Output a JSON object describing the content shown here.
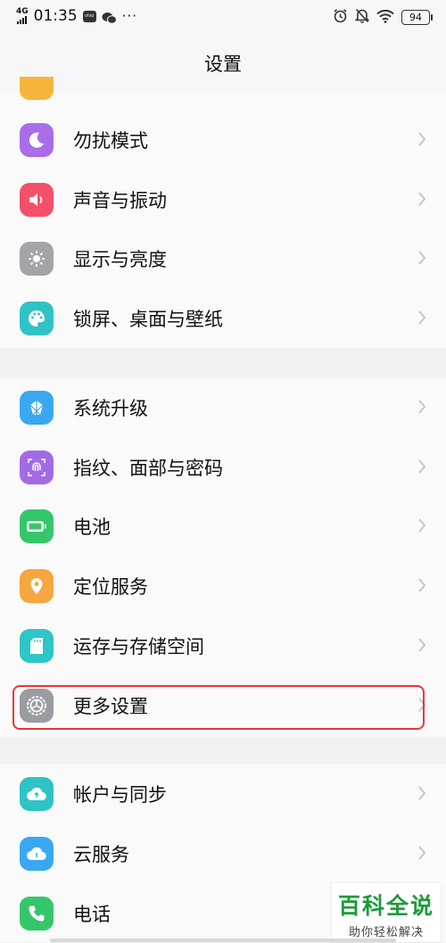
{
  "status_bar": {
    "network": "4G",
    "time": "01:35",
    "app_badge": "vivo",
    "battery": "94"
  },
  "header": {
    "title": "设置"
  },
  "sections": [
    {
      "items": [
        {
          "label": "勿扰模式",
          "icon": "moon-icon",
          "color": "#a76ee8"
        },
        {
          "label": "声音与振动",
          "icon": "speaker-icon",
          "color": "#f2506b"
        },
        {
          "label": "显示与亮度",
          "icon": "sun-icon",
          "color": "#a3a3a8"
        },
        {
          "label": "锁屏、桌面与壁纸",
          "icon": "palette-icon",
          "color": "#2fc3c5"
        }
      ]
    },
    {
      "items": [
        {
          "label": "系统升级",
          "icon": "system-upgrade-icon",
          "color": "#3aa8f0"
        },
        {
          "label": "指纹、面部与密码",
          "icon": "fingerprint-icon",
          "color": "#a36ae6"
        },
        {
          "label": "电池",
          "icon": "battery-icon",
          "color": "#34c76a"
        },
        {
          "label": "定位服务",
          "icon": "location-pin-icon",
          "color": "#f7a640"
        },
        {
          "label": "运存与存储空间",
          "icon": "storage-card-icon",
          "color": "#2ec6c6"
        },
        {
          "label": "更多设置",
          "icon": "gear-icon",
          "color": "#9b9ba2"
        }
      ]
    },
    {
      "items": [
        {
          "label": "帐户与同步",
          "icon": "cloud-sync-icon",
          "color": "#2fc3c5"
        },
        {
          "label": "云服务",
          "icon": "cloud-icon",
          "color": "#3aa8f0"
        },
        {
          "label": "电话",
          "icon": "phone-icon",
          "color": "#34c76a"
        }
      ]
    }
  ],
  "watermark": {
    "brand": "百科全说",
    "slogan": "助你轻松解决"
  }
}
